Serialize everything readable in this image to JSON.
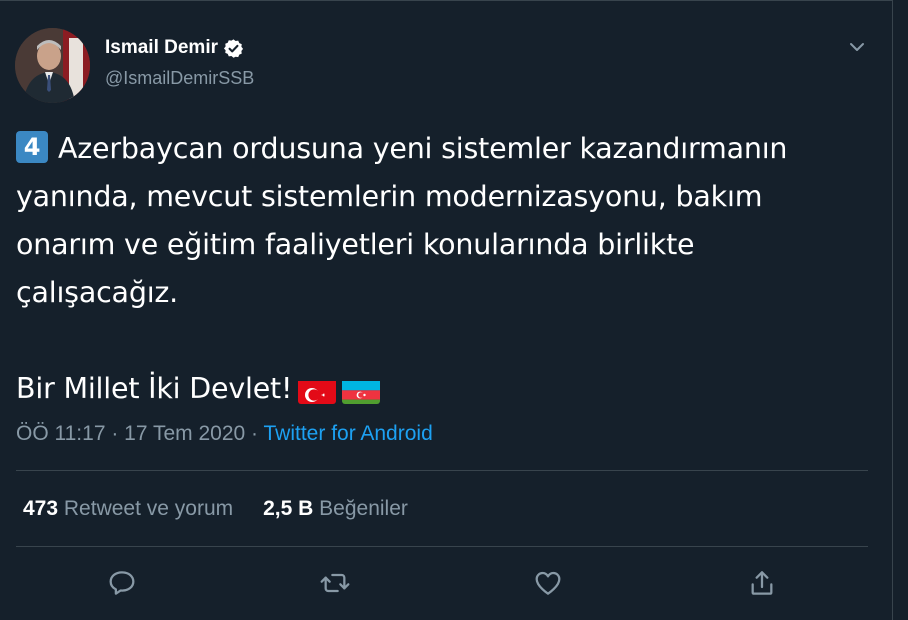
{
  "author": {
    "name": "Ismail Demir",
    "handle": "@IsmailDemirSSB"
  },
  "tweet": {
    "number_emoji": "4",
    "line1": "Azerbaycan ordusuna yeni sistemler kazandırmanın",
    "line2": "yanında, mevcut sistemlerin modernizasyonu, bakım",
    "line3": "onarım ve eğitim faaliyetleri konularında birlikte",
    "line4": "çalışacağız.",
    "line5": "Bir Millet İki Devlet!"
  },
  "meta": {
    "time": "ÖÖ 11:17",
    "sep1": " · ",
    "date": "17 Tem 2020",
    "sep2": " · ",
    "source": "Twitter for Android"
  },
  "stats": {
    "retweets_count": "473",
    "retweets_label": "Retweet ve yorum",
    "likes_count": "2,5 B",
    "likes_label": "Beğeniler"
  },
  "colors": {
    "background": "#15202b",
    "accent": "#1da1f2",
    "secondary_text": "#8899a6",
    "border": "#38444d"
  },
  "icons": {
    "verified": "verified-badge-icon",
    "caret": "chevron-down-icon",
    "reply": "reply-icon",
    "retweet": "retweet-icon",
    "like": "heart-icon",
    "share": "share-icon"
  }
}
